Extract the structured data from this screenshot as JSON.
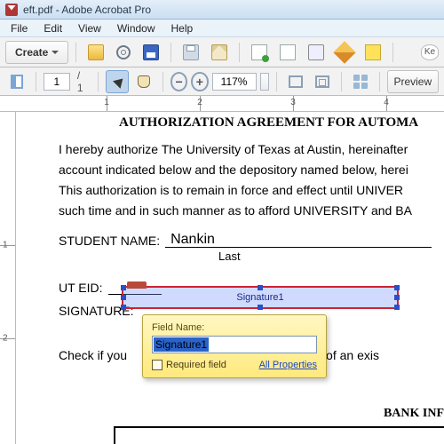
{
  "window": {
    "title": "eft.pdf - Adobe Acrobat Pro"
  },
  "menu": {
    "file": "File",
    "edit": "Edit",
    "view": "View",
    "window": "Window",
    "help": "Help"
  },
  "toolbar": {
    "create": "Create",
    "page_current": "1",
    "page_total": "1",
    "zoom": "117%",
    "preview": "Preview",
    "ke_fragment": "Ke"
  },
  "ruler": {
    "n1": "1",
    "n2": "2",
    "n3": "3",
    "n4": "4"
  },
  "vruler": {
    "n1": "1",
    "n2": "2"
  },
  "doc": {
    "heading": "AUTHORIZATION AGREEMENT FOR AUTOMA",
    "para1": "I hereby authorize The University of Texas at Austin, hereinafter",
    "para2": "account indicated below and the depository named below, herei",
    "para3": "This authorization is to remain in force and effect until UNIVER",
    "para4": "such time and in such manner as to afford UNIVERSITY and BA",
    "student_label": "STUDENT NAME:",
    "student_value": "Nankin",
    "last_label": "Last",
    "eid_label": "UT EID:",
    "sig_label": "SIGNATURE:",
    "check_line_a": "Check if you",
    "check_line_b": "of an exis",
    "bank_header": "BANK INF"
  },
  "sigfield": {
    "caption": "Signature1"
  },
  "popup": {
    "label": "Field Name:",
    "value": "Signature1",
    "required": "Required field",
    "allprops": "All Properties"
  }
}
